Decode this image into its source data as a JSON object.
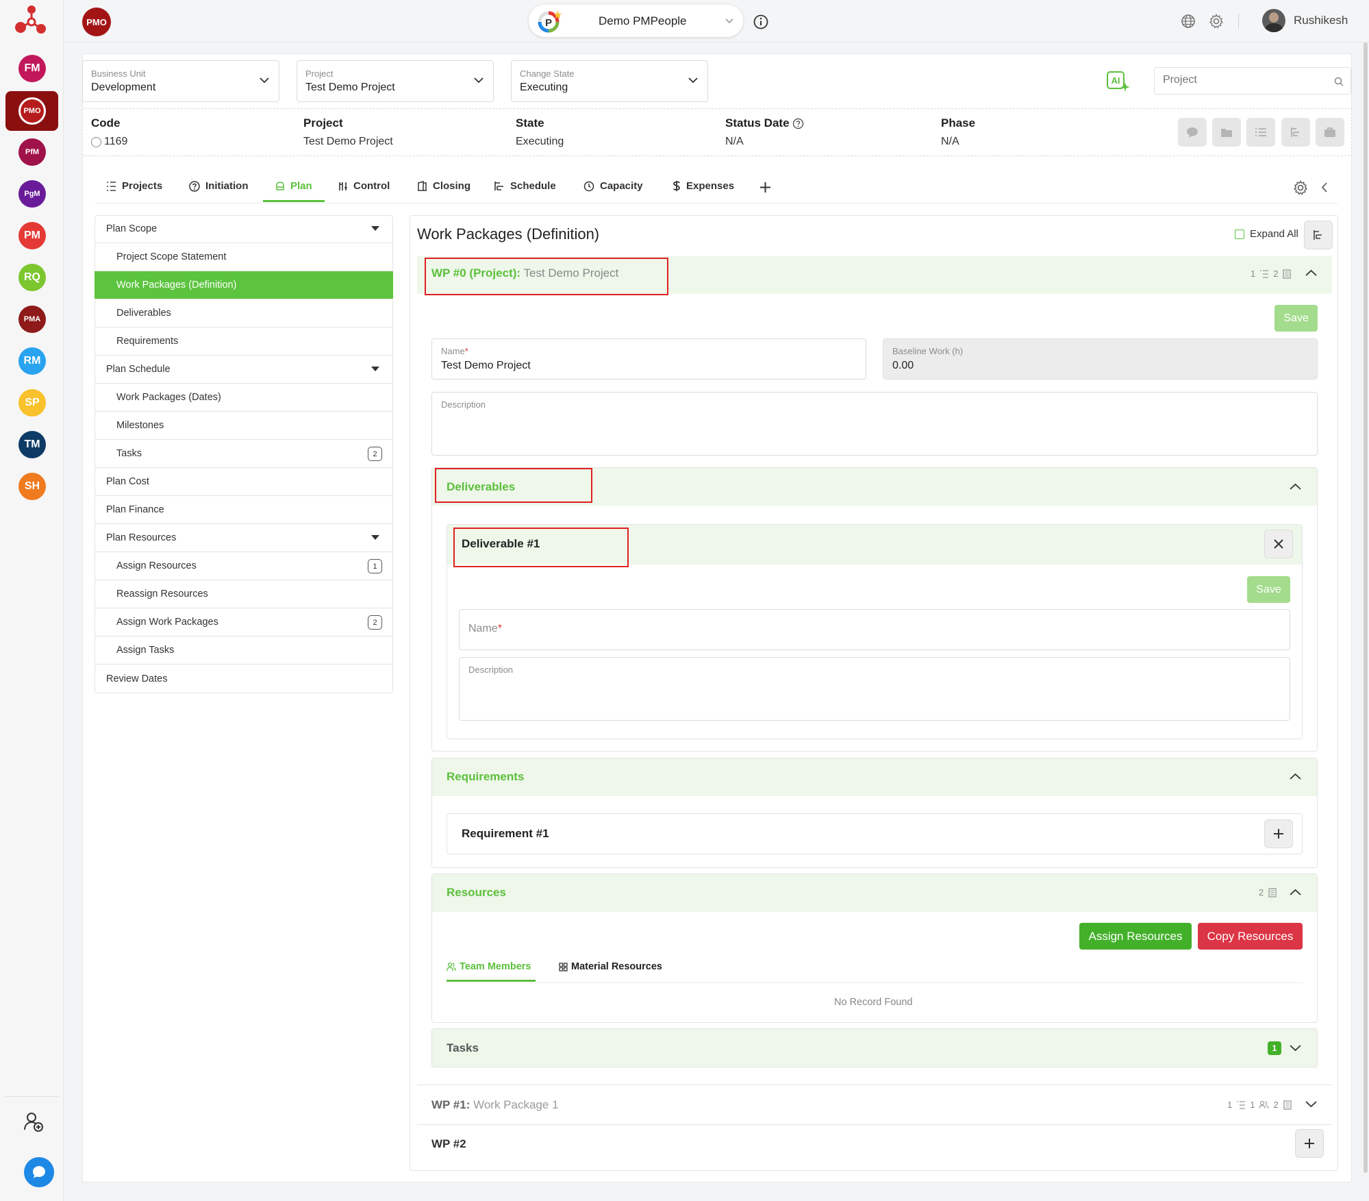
{
  "sidebar": {
    "apps": [
      {
        "label": "FM",
        "color": "#c2185b"
      },
      {
        "label": "PMO",
        "color": "#b71c1c"
      },
      {
        "label": "PfM",
        "color": "#a0124a"
      },
      {
        "label": "PgM",
        "color": "#6a1b9a"
      },
      {
        "label": "PM",
        "color": "#e53935"
      },
      {
        "label": "RQ",
        "color": "#7cc62e"
      },
      {
        "label": "PMA",
        "color": "#8e1a1a"
      },
      {
        "label": "RM",
        "color": "#29a3f0"
      },
      {
        "label": "SP",
        "color": "#f9c12b"
      },
      {
        "label": "TM",
        "color": "#0d3b66"
      },
      {
        "label": "SH",
        "color": "#f07b1f"
      }
    ]
  },
  "topbar": {
    "badge": "PMO",
    "workspace": "Demo PMPeople",
    "user_name": "Rushikesh"
  },
  "filters": {
    "business_unit": {
      "label": "Business Unit",
      "value": "Development"
    },
    "project": {
      "label": "Project",
      "value": "Test Demo Project"
    },
    "change_state": {
      "label": "Change State",
      "value": "Executing"
    },
    "ai_label": "AI",
    "search_placeholder": "Project"
  },
  "info": {
    "code_label": "Code",
    "code_value": "1169",
    "project_label": "Project",
    "project_value": "Test Demo Project",
    "state_label": "State",
    "state_value": "Executing",
    "status_date_label": "Status Date",
    "status_date_value": "N/A",
    "phase_label": "Phase",
    "phase_value": "N/A"
  },
  "tabs": [
    "Projects",
    "Initiation",
    "Plan",
    "Control",
    "Closing",
    "Schedule",
    "Capacity",
    "Expenses"
  ],
  "nav": [
    {
      "label": "Plan Scope",
      "type": "top",
      "caret": true
    },
    {
      "label": "Project Scope Statement",
      "type": "sub"
    },
    {
      "label": "Work Packages (Definition)",
      "type": "sub",
      "active": true
    },
    {
      "label": "Deliverables",
      "type": "sub"
    },
    {
      "label": "Requirements",
      "type": "sub"
    },
    {
      "label": "Plan Schedule",
      "type": "top",
      "caret": true
    },
    {
      "label": "Work Packages (Dates)",
      "type": "sub"
    },
    {
      "label": "Milestones",
      "type": "sub"
    },
    {
      "label": "Tasks",
      "type": "sub",
      "count": "2"
    },
    {
      "label": "Plan Cost",
      "type": "top"
    },
    {
      "label": "Plan Finance",
      "type": "top"
    },
    {
      "label": "Plan Resources",
      "type": "top",
      "caret": true
    },
    {
      "label": "Assign Resources",
      "type": "sub",
      "count": "1"
    },
    {
      "label": "Reassign Resources",
      "type": "sub"
    },
    {
      "label": "Assign Work Packages",
      "type": "sub",
      "count": "2"
    },
    {
      "label": "Assign Tasks",
      "type": "sub"
    },
    {
      "label": "Review Dates",
      "type": "top"
    }
  ],
  "main": {
    "title": "Work Packages (Definition)",
    "expand_all": "Expand All",
    "wp0": {
      "prefix": "WP #0 (Project):",
      "name": "Test Demo Project",
      "meta1": "1",
      "meta2": "2",
      "save": "Save",
      "name_label": "Name",
      "name_value": "Test Demo Project",
      "baseline_label": "Baseline Work (h)",
      "baseline_value": "0.00",
      "description_label": "Description"
    },
    "deliverables": {
      "title": "Deliverables",
      "item_title": "Deliverable #1",
      "save": "Save",
      "name_label": "Name",
      "description_label": "Description"
    },
    "requirements": {
      "title": "Requirements",
      "item_title": "Requirement #1"
    },
    "resources": {
      "title": "Resources",
      "count": "2",
      "assign_btn": "Assign Resources",
      "copy_btn": "Copy Resources",
      "tab_team": "Team Members",
      "tab_material": "Material Resources",
      "empty": "No Record Found"
    },
    "tasks": {
      "title": "Tasks",
      "count": "1"
    },
    "wp1": {
      "prefix": "WP #1:",
      "name": "Work Package 1",
      "m1": "1",
      "m2": "1",
      "m3": "2"
    },
    "wp2": {
      "label": "WP #2"
    }
  }
}
